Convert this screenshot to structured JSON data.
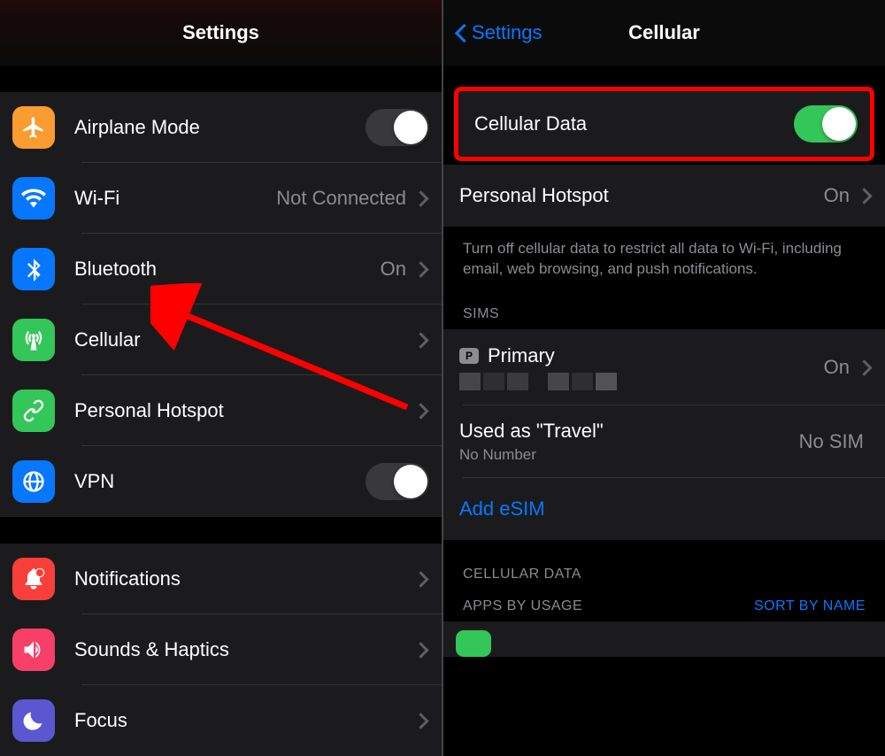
{
  "left": {
    "title": "Settings",
    "groups": {
      "network": {
        "airplane": {
          "label": "Airplane Mode",
          "toggle": "off"
        },
        "wifi": {
          "label": "Wi-Fi",
          "value": "Not Connected"
        },
        "bluetooth": {
          "label": "Bluetooth",
          "value": "On"
        },
        "cellular": {
          "label": "Cellular"
        },
        "hotspot": {
          "label": "Personal Hotspot"
        },
        "vpn": {
          "label": "VPN",
          "toggle": "off"
        }
      },
      "general": {
        "notifications": {
          "label": "Notifications"
        },
        "sounds": {
          "label": "Sounds & Haptics"
        },
        "focus": {
          "label": "Focus"
        }
      }
    }
  },
  "right": {
    "back": "Settings",
    "title": "Cellular",
    "cellular_data": {
      "label": "Cellular Data",
      "toggle": "on"
    },
    "hotspot": {
      "label": "Personal Hotspot",
      "value": "On"
    },
    "note": "Turn off cellular data to restrict all data to Wi-Fi, including email, web browsing, and push notifications.",
    "sims_header": "SIMs",
    "sims": {
      "primary": {
        "badge": "P",
        "label": "Primary",
        "value": "On"
      },
      "travel": {
        "label": "Used as \"Travel\"",
        "sub": "No Number",
        "value": "No SIM"
      },
      "add": "Add eSIM"
    },
    "cellular_data_header": "CELLULAR DATA",
    "usage_header": "APPS BY USAGE",
    "sort_action": "SORT BY NAME"
  },
  "icons": {
    "airplane": "airplane-icon",
    "wifi": "wifi-icon",
    "bluetooth": "bluetooth-icon",
    "cellular": "antenna-icon",
    "hotspot": "link-icon",
    "vpn": "globe-icon",
    "notifications": "bell-icon",
    "sounds": "speaker-icon",
    "focus": "moon-icon"
  }
}
